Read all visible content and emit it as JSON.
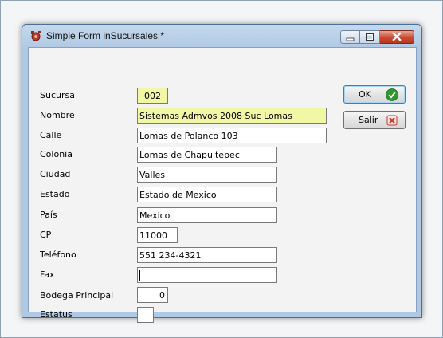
{
  "window": {
    "title": "Simple Form inSucursales *"
  },
  "icons": {
    "app": "gear-red-icon",
    "minimize": "minimize-icon",
    "maximize": "maximize-icon",
    "close": "close-icon",
    "ok": "check-circle-icon",
    "cancel": "x-close-icon"
  },
  "colors": {
    "highlight_field": "#f2f7a6",
    "ok_icon": "#2e9a2e",
    "cancel_icon": "#c8352a"
  },
  "form": {
    "fields": [
      {
        "key": "sucursal",
        "label": "Sucursal",
        "value": "002"
      },
      {
        "key": "nombre",
        "label": "Nombre",
        "value": "Sistemas Admvos 2008 Suc Lomas"
      },
      {
        "key": "calle",
        "label": "Calle",
        "value": "Lomas de Polanco 103"
      },
      {
        "key": "colonia",
        "label": "Colonia",
        "value": "Lomas de Chapultepec"
      },
      {
        "key": "ciudad",
        "label": "Ciudad",
        "value": "Valles"
      },
      {
        "key": "estado",
        "label": "Estado",
        "value": "Estado de Mexico"
      },
      {
        "key": "pais",
        "label": "País",
        "value": "Mexico"
      },
      {
        "key": "cp",
        "label": "CP",
        "value": "11000"
      },
      {
        "key": "telefono",
        "label": "Teléfono",
        "value": "551 234-4321"
      },
      {
        "key": "fax",
        "label": "Fax",
        "value": ""
      },
      {
        "key": "bodega",
        "label": "Bodega Principal",
        "value": "0"
      },
      {
        "key": "estatus",
        "label": "Estatus",
        "value": ""
      }
    ]
  },
  "buttons": {
    "ok": "OK",
    "salir": "Salir"
  }
}
